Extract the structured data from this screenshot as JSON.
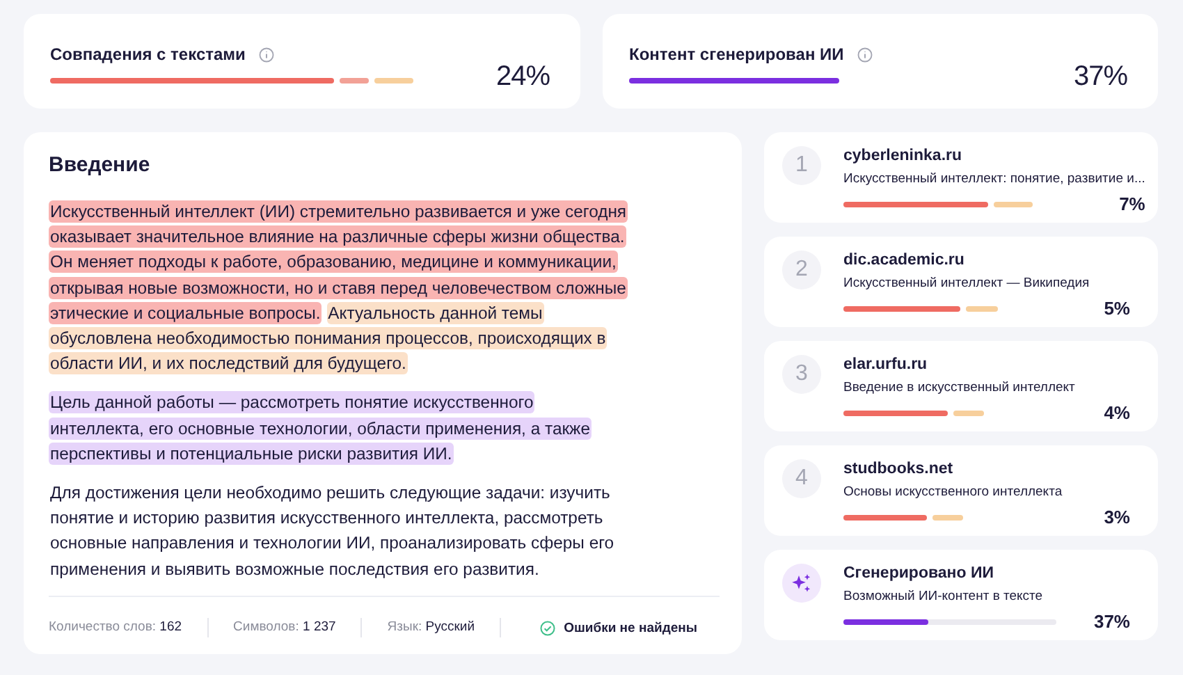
{
  "summary": [
    {
      "title": "Совпадения с текстами",
      "value": "24%",
      "segments": [
        {
          "kind": "match"
        },
        {
          "kind": "partial"
        },
        {
          "kind": "weak"
        }
      ]
    },
    {
      "title": "Контент сгенерирован ИИ",
      "value": "37%",
      "segments": [
        {
          "kind": "ai"
        }
      ]
    }
  ],
  "document": {
    "title": "Введение",
    "paragraphs": [
      {
        "segments": [
          {
            "kind": "match",
            "text": "Искусственный интеллект (ИИ) стремительно развивается и уже сегодня оказывает значительное влияние на различные сферы жизни общества. Он меняет подходы к работе, образованию, медицине и коммуникации, открывая новые возможности, но и ставя перед человечеством сложные этические и социальные вопросы."
          },
          {
            "kind": "weak",
            "text": "Актуальность данной темы обусловлена необходимостью понимания процессов, происходящих в области ИИ, и их последствий для будущего."
          }
        ]
      },
      {
        "segments": [
          {
            "kind": "ai",
            "text": "Цель данной работы — рассмотреть понятие искусственного интеллекта, его основные технологии, области применения, а также перспективы и потенциальные риски развития ИИ."
          }
        ]
      },
      {
        "segments": [
          {
            "kind": "plain",
            "text": "Для достижения цели необходимо решить следующие задачи: изучить понятие и историю развития искусственного интеллекта, рассмотреть основные направления и технологии ИИ, проанализировать сферы его применения и выявить возможные последствия его развития."
          }
        ]
      }
    ],
    "stats": [
      {
        "label": "Количество слов:",
        "value": "162"
      },
      {
        "label": "Символов:",
        "value": "1 237"
      },
      {
        "label": "Язык:",
        "value": "Русский"
      }
    ],
    "check": "Ошибки не найдены"
  },
  "sources": [
    {
      "kind": "source",
      "number": "1",
      "site": "cyberleninka.ru",
      "title": "Искусственный интеллект: понятие, развитие и...",
      "value": "7%",
      "segments": [
        {
          "kind": "match"
        },
        {
          "kind": "weak"
        }
      ]
    },
    {
      "kind": "source",
      "number": "2",
      "site": "dic.academic.ru",
      "title": "Искусственный интеллект — Википедия",
      "value": "5%",
      "segments": [
        {
          "kind": "match"
        },
        {
          "kind": "weak"
        }
      ]
    },
    {
      "kind": "source",
      "number": "3",
      "site": "elar.urfu.ru",
      "title": "Введение в искусственный интеллект",
      "value": "4%",
      "segments": [
        {
          "kind": "match"
        },
        {
          "kind": "weak"
        }
      ]
    },
    {
      "kind": "source",
      "number": "4",
      "site": "studbooks.net",
      "title": "Основы искусственного интеллекта",
      "value": "3%",
      "segments": [
        {
          "kind": "match"
        },
        {
          "kind": "weak"
        }
      ]
    },
    {
      "kind": "ai",
      "site": "Сгенерировано ИИ",
      "title": "Возможный ИИ-контент в тексте",
      "value": "37%",
      "segments": [
        {
          "kind": "ai",
          "level": 0.4
        }
      ]
    }
  ]
}
